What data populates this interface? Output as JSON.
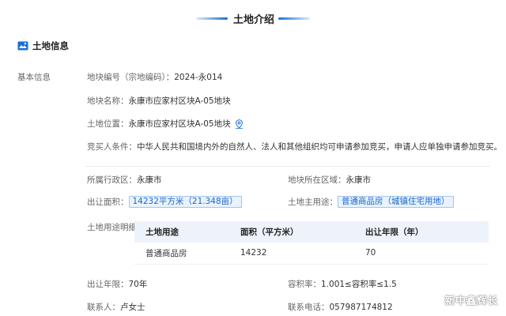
{
  "page_title": "土地介绍",
  "section": {
    "title": "土地信息"
  },
  "basic": {
    "group_label": "基本信息",
    "parcel_no": {
      "label": "地块编号（宗地编码）：",
      "value": "2024-永014"
    },
    "parcel_name": {
      "label": "地块名称：",
      "value": "永康市应家村区块A-05地块"
    },
    "parcel_location": {
      "label": "土地位置：",
      "value": "永康市应家村区块A-05地块"
    },
    "bidder_conditions": {
      "label": "竞买人条件：",
      "value": "中华人民共和国境内外的自然人、法人和其他组织均可申请参加竞买，申请人应单独申请参加竞买。"
    }
  },
  "details": {
    "admin_region": {
      "label": "所属行政区：",
      "value": "永康市"
    },
    "parcel_area_region": {
      "label": "地块所在区域：",
      "value": "永康市"
    },
    "transfer_area": {
      "label": "出让面积：",
      "value": "14232平方米（21.348亩）"
    },
    "main_use": {
      "label": "土地主用途：",
      "value": "普通商品房（城镇住宅用地）"
    },
    "usage_detail_label": "土地用途明细：",
    "usage_table": {
      "headers": [
        "土地用途",
        "面积（平方米）",
        "出让年限（年）"
      ],
      "rows": [
        [
          "普通商品房",
          "14232",
          "70"
        ]
      ]
    },
    "transfer_term": {
      "label": "出让年限：",
      "value": "70年"
    },
    "plot_ratio": {
      "label": "容积率：",
      "value": "1.001≤容积率≤1.5"
    },
    "contact": {
      "label": "联系人：",
      "value": "卢女士"
    },
    "phone": {
      "label": "联系电话：",
      "value": "057987174812"
    }
  },
  "watermark": {
    "text": "新中鑫辉长"
  },
  "colors": {
    "accent": "#1a6fd6",
    "tag_bg": "#eaf3fd",
    "tag_border": "#9cc4f2"
  },
  "icons": {
    "section": "map-icon",
    "location": "location-pin-icon"
  }
}
